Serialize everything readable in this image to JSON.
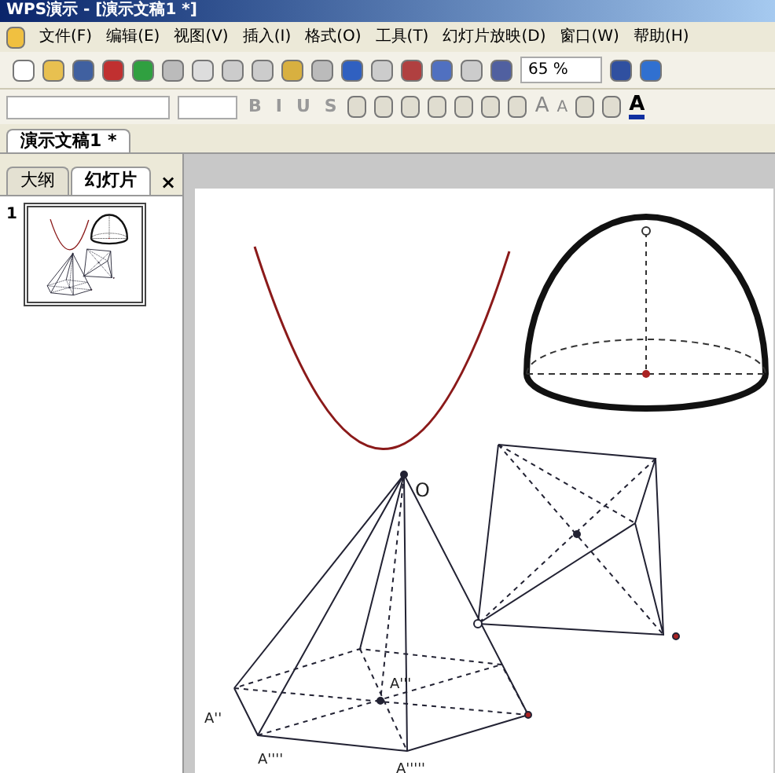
{
  "window": {
    "title": "WPS演示 - [演示文稿1 *]"
  },
  "menu": [
    "文件(F)",
    "编辑(E)",
    "视图(V)",
    "插入(I)",
    "格式(O)",
    "工具(T)",
    "幻灯片放映(D)",
    "窗口(W)",
    "帮助(H)"
  ],
  "toolbar": {
    "zoom": "65 %"
  },
  "format_toolbar": {
    "style_buttons": [
      "B",
      "I",
      "U",
      "S"
    ],
    "size_buttons": [
      "A",
      "A"
    ],
    "color_button": "A"
  },
  "document_tab": {
    "label": "演示文稿1 *"
  },
  "pane_tabs": [
    {
      "label": "大纲",
      "selected": false
    },
    {
      "label": "幻灯片",
      "selected": true
    }
  ],
  "pane_close": "×",
  "thumbnails": [
    {
      "number": "1",
      "selected": true
    }
  ],
  "slide": {
    "labels": [
      "O",
      "A'''",
      "A''",
      "A''''",
      "A'''''"
    ]
  }
}
